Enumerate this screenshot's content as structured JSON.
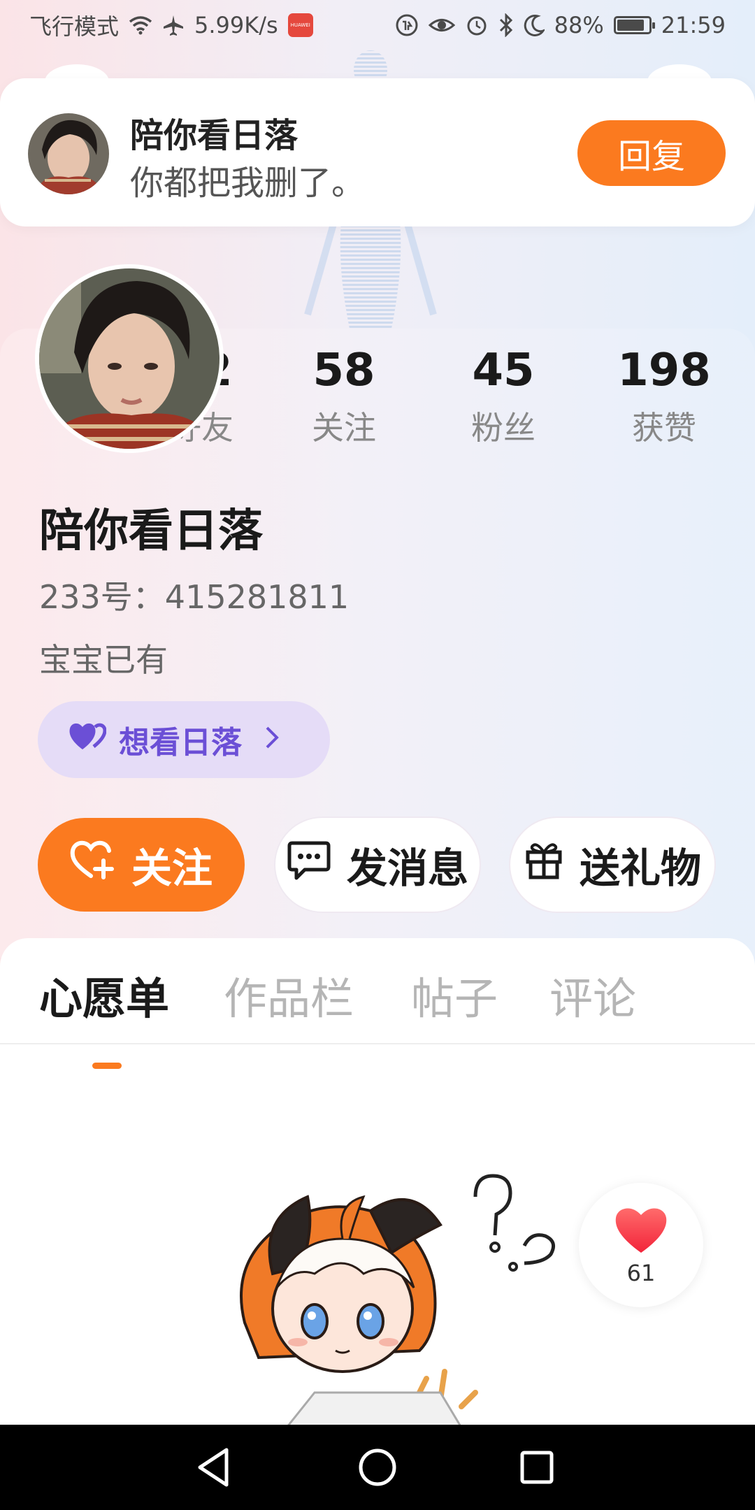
{
  "status_bar": {
    "mode": "飞行模式",
    "speed": "5.99K/s",
    "battery": "88%",
    "battery_level": 0.88,
    "time": "21:59"
  },
  "notification": {
    "name": "陪你看日落",
    "message": "你都把我删了。",
    "reply_label": "回复"
  },
  "stats": [
    {
      "value": "42",
      "label": "好友"
    },
    {
      "value": "58",
      "label": "关注"
    },
    {
      "value": "45",
      "label": "粉丝"
    },
    {
      "value": "198",
      "label": "获赞"
    }
  ],
  "profile": {
    "name": "陪你看日落",
    "id_line": "233号：415281811",
    "bio": "宝宝已有",
    "mood_tag": "想看日落"
  },
  "actions": {
    "follow": "关注",
    "message": "发消息",
    "gift": "送礼物"
  },
  "tabs": [
    {
      "label": "心愿单",
      "active": true
    },
    {
      "label": "作品栏",
      "active": false
    },
    {
      "label": "帖子",
      "active": false
    },
    {
      "label": "评论",
      "active": false
    }
  ],
  "like_count": "61",
  "colors": {
    "accent": "#fb7a1f",
    "mood_bg": "#e5dcf7",
    "mood_text": "#6b4fd6"
  }
}
